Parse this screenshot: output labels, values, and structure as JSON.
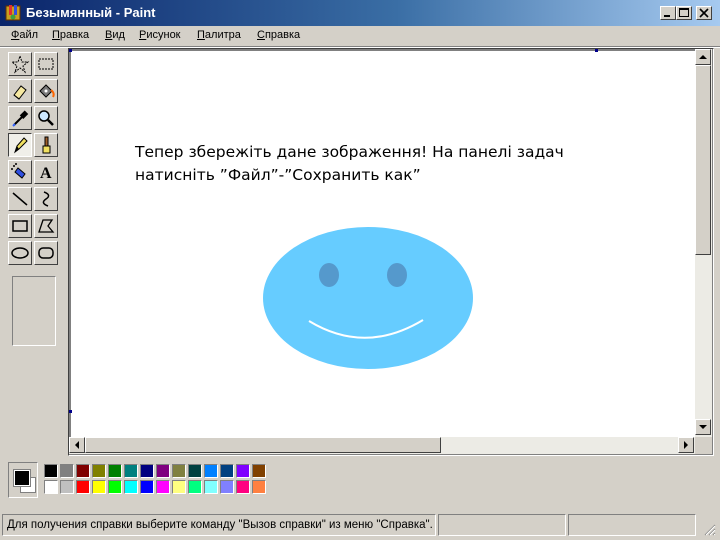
{
  "window": {
    "title": "Безымянный - Paint"
  },
  "menu": [
    {
      "ul": "Ф",
      "rest": "айл"
    },
    {
      "ul": "П",
      "rest": "равка"
    },
    {
      "ul": "В",
      "rest": "ид"
    },
    {
      "ul": "Р",
      "rest": "исунок"
    },
    {
      "ul": "П",
      "rest": "алитра"
    },
    {
      "ul": "С",
      "rest": "правка"
    }
  ],
  "tools": [
    {
      "name": "free-form-select-tool",
      "icon": "star-select-icon",
      "selected": false
    },
    {
      "name": "rect-select-tool",
      "icon": "rect-select-icon",
      "selected": false
    },
    {
      "name": "eraser-tool",
      "icon": "eraser-icon",
      "selected": false
    },
    {
      "name": "fill-tool",
      "icon": "paint-bucket-icon",
      "selected": false
    },
    {
      "name": "pick-color-tool",
      "icon": "eyedropper-icon",
      "selected": false
    },
    {
      "name": "magnifier-tool",
      "icon": "magnifier-icon",
      "selected": false
    },
    {
      "name": "pencil-tool",
      "icon": "pencil-icon",
      "selected": true
    },
    {
      "name": "brush-tool",
      "icon": "brush-icon",
      "selected": false
    },
    {
      "name": "airbrush-tool",
      "icon": "airbrush-icon",
      "selected": false
    },
    {
      "name": "text-tool",
      "icon": "text-icon",
      "selected": false
    },
    {
      "name": "line-tool",
      "icon": "line-icon",
      "selected": false
    },
    {
      "name": "curve-tool",
      "icon": "curve-icon",
      "selected": false
    },
    {
      "name": "rectangle-tool",
      "icon": "rectangle-icon",
      "selected": false
    },
    {
      "name": "polygon-tool",
      "icon": "polygon-icon",
      "selected": false
    },
    {
      "name": "ellipse-tool",
      "icon": "ellipse-icon",
      "selected": false
    },
    {
      "name": "rounded-rect-tool",
      "icon": "rounded-rect-icon",
      "selected": false
    }
  ],
  "canvas": {
    "text_line1": "Тепер збережіть дане зображення! На панелі задач",
    "text_line2": "натисніть ”Файл”-”Сохранить как”",
    "smiley_color": "#66ccff",
    "eye_color": "#5599cc"
  },
  "palette": {
    "foreground": "#000000",
    "background": "#ffffff",
    "top_row": [
      "#000000",
      "#808080",
      "#800000",
      "#808000",
      "#008000",
      "#008080",
      "#000080",
      "#800080",
      "#808040",
      "#004040",
      "#0080ff",
      "#004080",
      "#8000ff",
      "#804000"
    ],
    "bottom_row": [
      "#ffffff",
      "#c0c0c0",
      "#ff0000",
      "#ffff00",
      "#00ff00",
      "#00ffff",
      "#0000ff",
      "#ff00ff",
      "#ffff80",
      "#00ff80",
      "#80ffff",
      "#8080ff",
      "#ff0080",
      "#ff8040"
    ]
  },
  "status": {
    "help": "Для получения справки выберите команду \"Вызов справки\" из меню \"Справка\".",
    "coords": "",
    "size": ""
  }
}
